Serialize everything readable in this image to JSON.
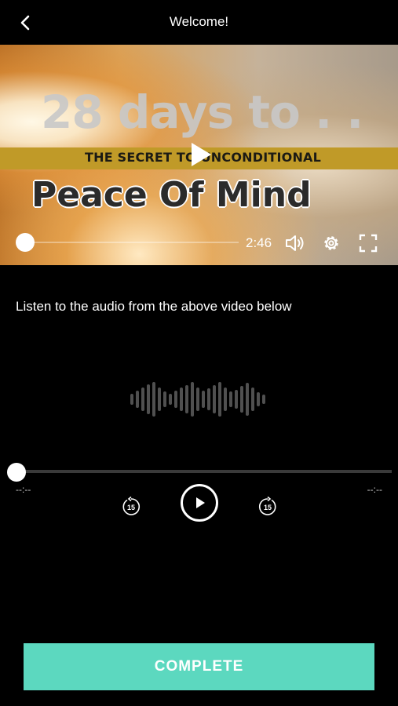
{
  "header": {
    "title": "Welcome!",
    "back_icon": "chevron-left-icon"
  },
  "video": {
    "thumbnail_text": {
      "line1": "28 days to . .",
      "line2": "THE SECRET TO UNCONDITIONAL",
      "line3": "Peace  Of  Mind"
    },
    "progress": 0,
    "duration": "2:46",
    "icons": [
      "play-icon",
      "volume-icon",
      "settings-gear-icon",
      "fullscreen-icon"
    ],
    "band_color": "#c09a28"
  },
  "caption": "Listen to the audio from the above video below",
  "audio": {
    "elapsed": "--:--",
    "remaining": "--:--",
    "progress": 0,
    "skip_back_seconds": "15",
    "skip_forward_seconds": "15",
    "icons": [
      "waveform-icon",
      "rewind-15-icon",
      "play-icon",
      "forward-15-icon"
    ]
  },
  "complete_button": {
    "label": "COMPLETE",
    "color": "#5cd8bf"
  }
}
